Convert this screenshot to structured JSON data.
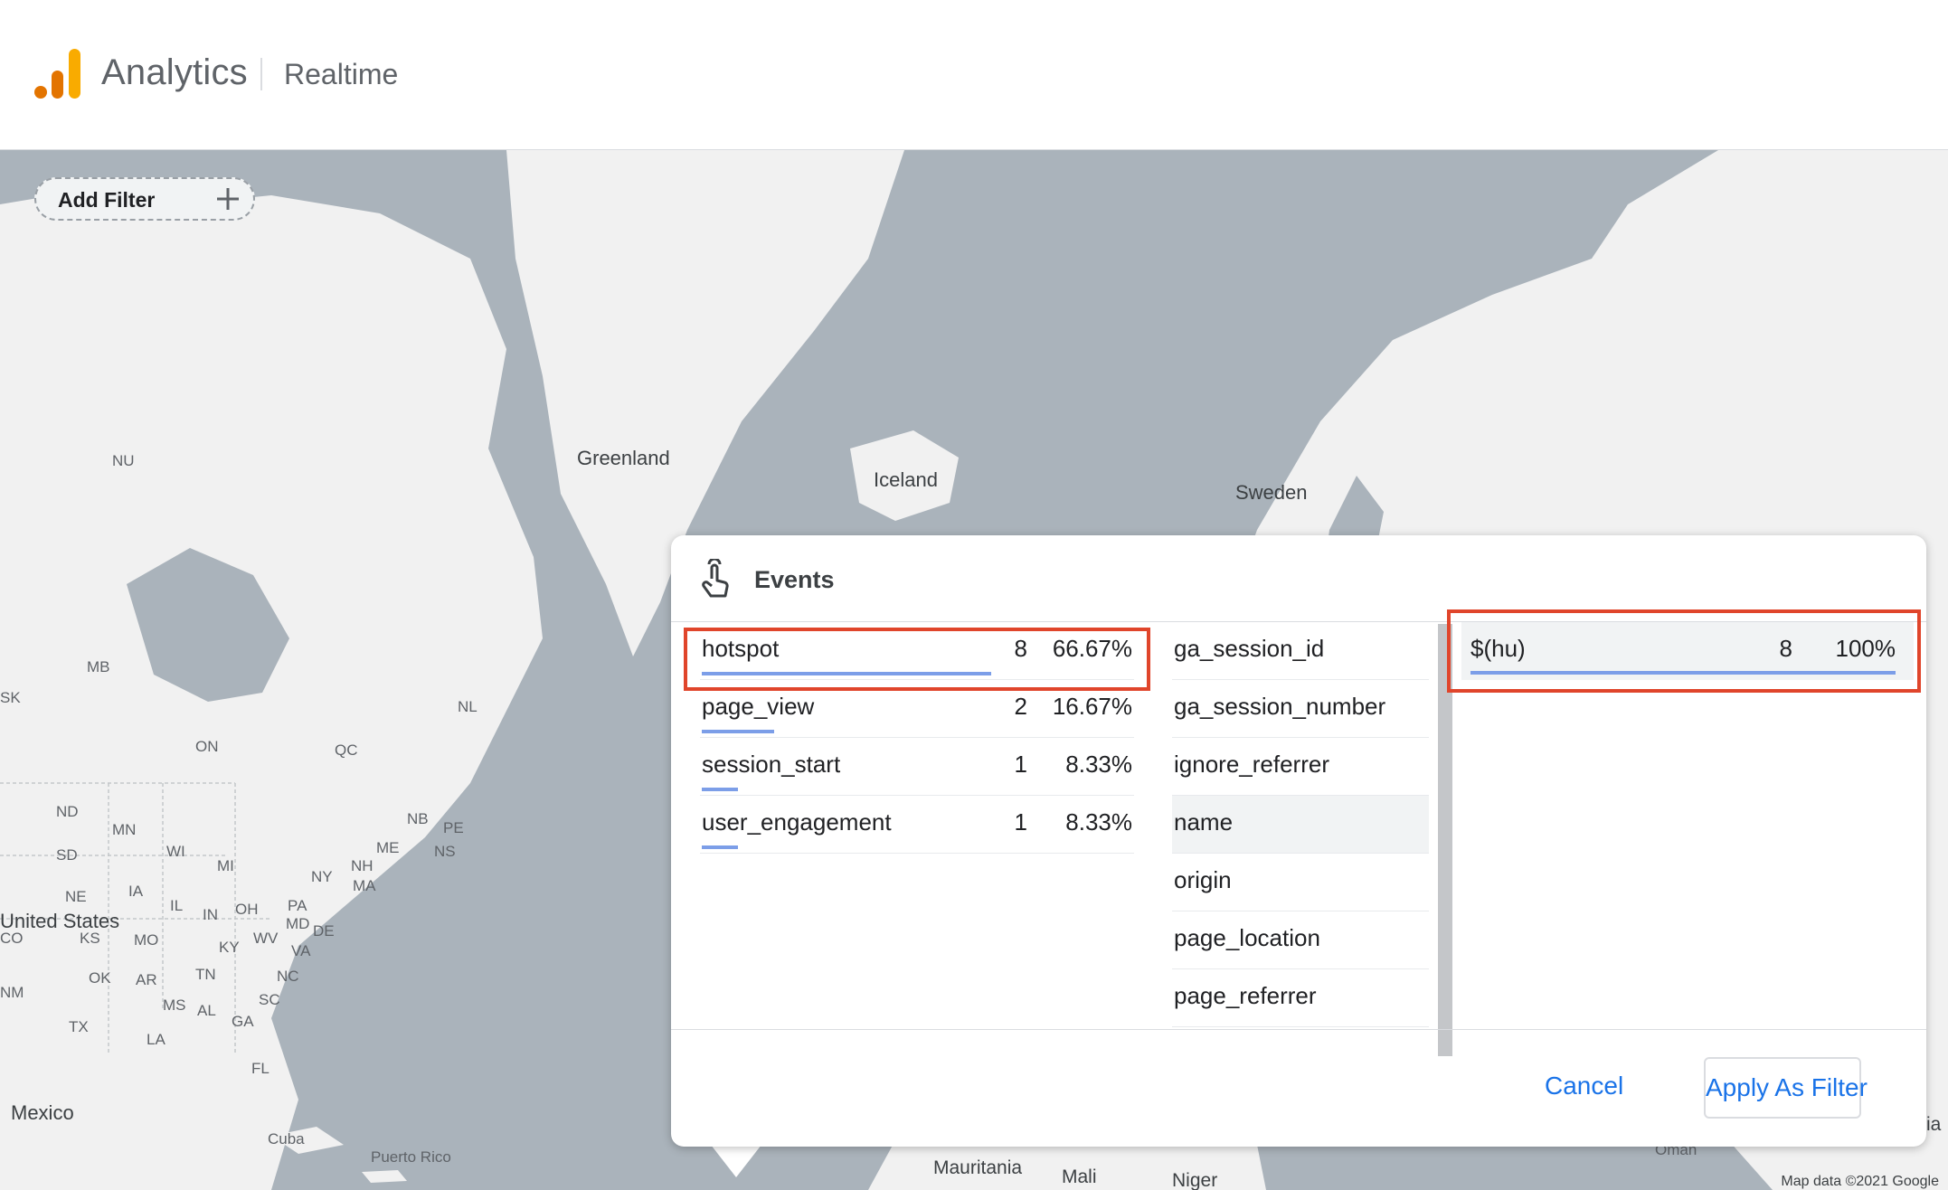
{
  "header": {
    "brand": "Analytics",
    "section": "Realtime",
    "logo_colors": [
      "#e37400",
      "#e37400",
      "#f9ab00"
    ]
  },
  "map": {
    "add_filter_label": "Add Filter",
    "labels": {
      "greenland": "Greenland",
      "iceland": "Iceland",
      "sweden": "Sweden",
      "nu": "NU",
      "mb": "MB",
      "sk": "SK",
      "on": "ON",
      "qc": "QC",
      "nl": "NL",
      "nb": "NB",
      "pe": "PE",
      "ns": "NS",
      "me": "ME",
      "nh": "NH",
      "ma": "MA",
      "ny": "NY",
      "pa": "PA",
      "md": "MD",
      "de": "DE",
      "nd": "ND",
      "mn": "MN",
      "sd": "SD",
      "wi": "WI",
      "mi": "MI",
      "ne": "NE",
      "ia": "IA",
      "il": "IL",
      "in": "IN",
      "oh": "OH",
      "wv": "WV",
      "va": "VA",
      "us": "United States",
      "co": "CO",
      "ks": "KS",
      "mo": "MO",
      "ky": "KY",
      "nm": "NM",
      "ok": "OK",
      "ar": "AR",
      "tn": "TN",
      "nc": "NC",
      "ms": "MS",
      "al": "AL",
      "sc": "SC",
      "ga": "GA",
      "tx": "TX",
      "la": "LA",
      "fl": "FL",
      "mexico": "Mexico",
      "cuba": "Cuba",
      "puerto_rico": "Puerto Rico",
      "mauritania": "Mauritania",
      "mali": "Mali",
      "niger": "Niger",
      "oman": "Oman",
      "ia_edge": "ia"
    },
    "attribution": "Map data ©2021 Google"
  },
  "popup": {
    "title": "Events",
    "events": [
      {
        "name": "hotspot",
        "count": "8",
        "pct": "66.67%",
        "share": 0.6667
      },
      {
        "name": "page_view",
        "count": "2",
        "pct": "16.67%",
        "share": 0.1667
      },
      {
        "name": "session_start",
        "count": "1",
        "pct": "8.33%",
        "share": 0.0833
      },
      {
        "name": "user_engagement",
        "count": "1",
        "pct": "8.33%",
        "share": 0.0833
      }
    ],
    "params": [
      "ga_session_id",
      "ga_session_number",
      "ignore_referrer",
      "name",
      "origin",
      "page_location",
      "page_referrer"
    ],
    "active_param": "name",
    "values": [
      {
        "name": "$(hu)",
        "count": "8",
        "pct": "100%",
        "share": 1.0
      }
    ],
    "cancel_label": "Cancel",
    "apply_label": "Apply As Filter"
  }
}
